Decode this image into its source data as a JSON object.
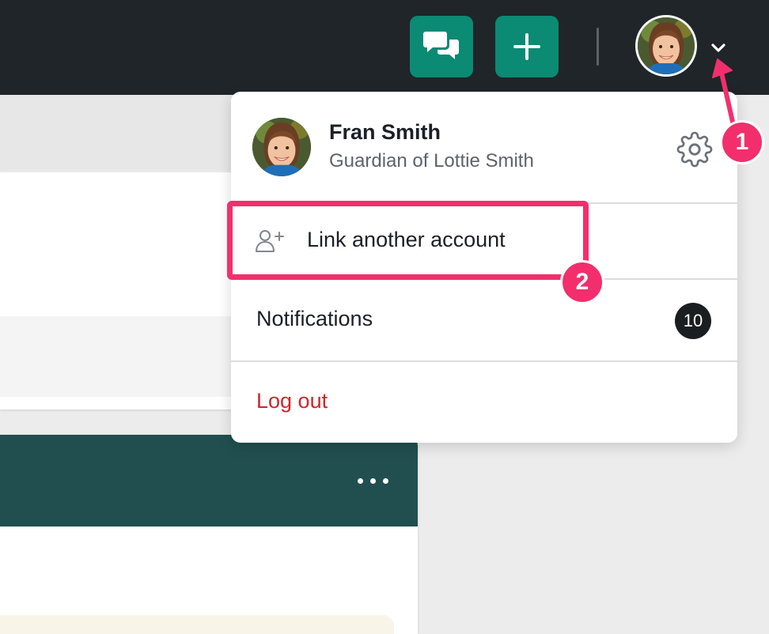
{
  "topbar": {
    "chat_icon": "chat-bubbles-icon",
    "add_icon": "plus-icon",
    "avatar_icon": "user-avatar",
    "dropdown_icon": "chevron-down-icon",
    "accent_color": "#0b8a74",
    "bar_color": "#1f2529"
  },
  "dropdown": {
    "user": {
      "name": "Fran Smith",
      "subtitle": "Guardian of Lottie Smith"
    },
    "settings_icon": "gear-icon",
    "link_account": {
      "icon": "person-plus-icon",
      "label": "Link another account"
    },
    "notifications": {
      "label": "Notifications",
      "count": "10"
    },
    "logout": {
      "label": "Log out",
      "color": "#d0252c"
    }
  },
  "background": {
    "card_header_color": "#214f4f",
    "more_icon": "more-horizontal-icon"
  },
  "annotations": {
    "highlight_color": "#f22f6c",
    "step1": "1",
    "step2": "2"
  }
}
